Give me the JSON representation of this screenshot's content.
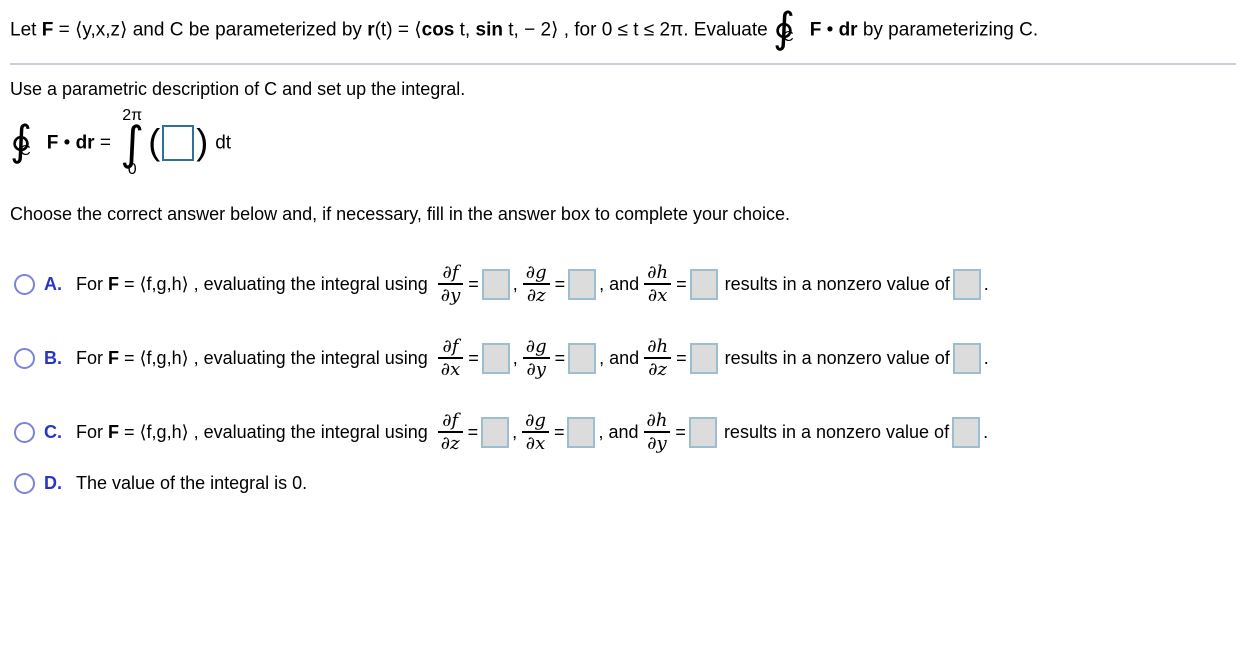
{
  "problem": {
    "lead": "Let ",
    "field_symbol": "F",
    "eq": " = ",
    "field_components": "⟨y,x,z⟩",
    "mid1": " and C be parameterized by ",
    "r_symbol": "r",
    "r_arg": "(t)",
    "eq2": " = ",
    "open_angle": "⟨",
    "cos_label": "cos",
    "cos_arg": " t, ",
    "sin_label": "sin",
    "sin_arg": " t, − 2",
    "close_angle": "⟩",
    "mid2": " , for 0 ≤ t ≤ 2π. Evaluate ",
    "contour_symbol": "∮",
    "contour_sub": "C",
    "dot_expr_F": "F",
    "dot": " • ",
    "dot_expr_dr": "dr",
    "tail": " by parameterizing C."
  },
  "setup": {
    "instruction": "Use a parametric description of C and set up the integral.",
    "lhs_contour": "∮",
    "lhs_sub": "C",
    "lhs_F": "F",
    "lhs_dot": " • ",
    "lhs_dr": "dr",
    "lhs_eq": " = ",
    "upper_limit": "2π",
    "integral_symbol": "∫",
    "lower_limit": "0",
    "paren_open": "(",
    "paren_close": ")",
    "answer_value": "",
    "differential": "dt"
  },
  "choose_instruction": "Choose the correct answer below and, if necessary, fill in the answer box to complete your choice.",
  "options": [
    {
      "letter": "A.",
      "prefix": "For ",
      "field_symbol": "F",
      "eq": " = ",
      "components": "⟨f,g,h⟩",
      "mid": " , evaluating the integral using ",
      "frac1_num": "∂f",
      "frac1_den": "∂y",
      "eq1": "=",
      "box1": "",
      "comma1": ",",
      "frac2_num": "∂g",
      "frac2_den": "∂z",
      "eq2": "=",
      "box2": "",
      "and_label": ", and",
      "frac3_num": "∂h",
      "frac3_den": "∂x",
      "eq3": "=",
      "box3": "",
      "result_text": "results in a nonzero value of",
      "box4": "",
      "period": "."
    },
    {
      "letter": "B.",
      "prefix": "For ",
      "field_symbol": "F",
      "eq": " = ",
      "components": "⟨f,g,h⟩",
      "mid": " , evaluating the integral using ",
      "frac1_num": "∂f",
      "frac1_den": "∂x",
      "eq1": "=",
      "box1": "",
      "comma1": ",",
      "frac2_num": "∂g",
      "frac2_den": "∂y",
      "eq2": "=",
      "box2": "",
      "and_label": ", and",
      "frac3_num": "∂h",
      "frac3_den": "∂z",
      "eq3": "=",
      "box3": "",
      "result_text": "results in a nonzero value of",
      "box4": "",
      "period": "."
    },
    {
      "letter": "C.",
      "prefix": "For ",
      "field_symbol": "F",
      "eq": " = ",
      "components": "⟨f,g,h⟩",
      "mid": " , evaluating the integral using ",
      "frac1_num": "∂f",
      "frac1_den": "∂z",
      "eq1": "=",
      "box1": "",
      "comma1": ",",
      "frac2_num": "∂g",
      "frac2_den": "∂x",
      "eq2": "=",
      "box2": "",
      "and_label": ", and",
      "frac3_num": "∂h",
      "frac3_den": "∂y",
      "eq3": "=",
      "box3": "",
      "result_text": "results in a nonzero value of",
      "box4": "",
      "period": "."
    }
  ],
  "option_d": {
    "letter": "D.",
    "text": "The value of the integral is 0."
  },
  "colors": {
    "radio_stroke": "#7b84d6",
    "letter_blue": "#2a35c7",
    "answer_box_fill": "#dcdcdc",
    "answer_box_border": "#9dbdd2",
    "active_box_border": "#2e7394",
    "divider": "#ccced9"
  }
}
